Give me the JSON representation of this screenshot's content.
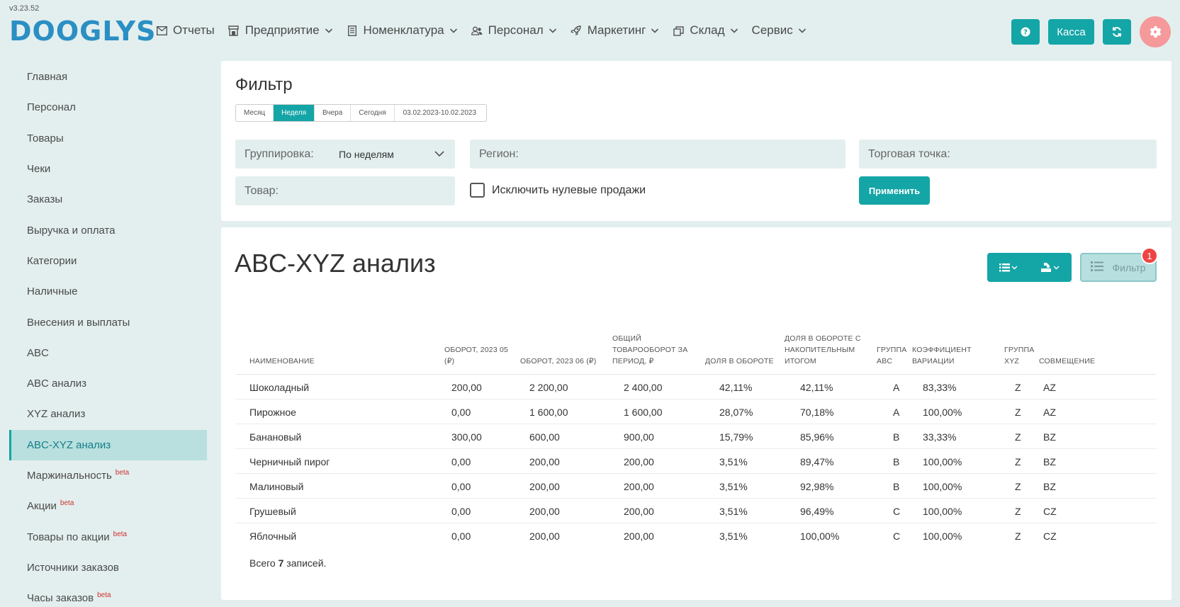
{
  "app": {
    "version": "v3.23.52",
    "logo": "DOOGLYS"
  },
  "nav": [
    {
      "label": "Отчеты",
      "icon": "envelope-icon",
      "dropdown": false
    },
    {
      "label": "Предприятие",
      "icon": "store-icon",
      "dropdown": true
    },
    {
      "label": "Номенклатура",
      "icon": "document-icon",
      "dropdown": true
    },
    {
      "label": "Персонал",
      "icon": "users-icon",
      "dropdown": true
    },
    {
      "label": "Маркетинг",
      "icon": "rocket-icon",
      "dropdown": true
    },
    {
      "label": "Склад",
      "icon": "boxes-icon",
      "dropdown": true
    },
    {
      "label": "Сервис",
      "icon": "",
      "dropdown": true
    }
  ],
  "header_buttons": {
    "help_icon": "question-icon",
    "kassa": "Касса",
    "refresh_icon": "refresh-icon",
    "settings_icon": "gear-icon"
  },
  "sidebar": [
    {
      "label": "Главная"
    },
    {
      "label": "Персонал"
    },
    {
      "label": "Товары"
    },
    {
      "label": "Чеки"
    },
    {
      "label": "Заказы"
    },
    {
      "label": "Выручка и оплата"
    },
    {
      "label": "Категории"
    },
    {
      "label": "Наличные"
    },
    {
      "label": "Внесения и выплаты"
    },
    {
      "label": "ABC"
    },
    {
      "label": "ABC анализ"
    },
    {
      "label": "XYZ анализ"
    },
    {
      "label": "ABC-XYZ анализ",
      "active": true
    },
    {
      "label": "Маржинальность",
      "beta": "beta"
    },
    {
      "label": "Акции",
      "beta": "beta"
    },
    {
      "label": "Товары по акции",
      "beta": "beta"
    },
    {
      "label": "Источники заказов"
    },
    {
      "label": "Часы заказов",
      "beta": "beta"
    }
  ],
  "filter": {
    "title": "Фильтр",
    "periods": [
      "Месяц",
      "Неделя",
      "Вчера",
      "Сегодня",
      "03.02.2023-10.02.2023"
    ],
    "selected_period": "Неделя",
    "grouping_label": "Группировка:",
    "grouping_value": "По неделям",
    "region_label": "Регион:",
    "outlet_label": "Торговая точка:",
    "product_label": "Товар:",
    "exclude_zero_label": "Исключить нулевые продажи",
    "exclude_zero_checked": false,
    "apply_label": "Применить"
  },
  "report": {
    "title": "ABC-XYZ анализ",
    "filter_button": "Фильтр",
    "filter_badge": "1",
    "columns": [
      "НАИМЕНОВАНИЕ",
      "ОБОРОТ, 2023 05 (₽)",
      "ОБОРОТ, 2023 06 (₽)",
      "ОБЩИЙ ТОВАРООБОРОТ ЗА ПЕРИОД, ₽",
      "ДОЛЯ В ОБОРОТЕ",
      "ДОЛЯ В ОБОРОТЕ С НАКОПИТЕЛЬНЫМ ИТОГОМ",
      "ГРУППА ABC",
      "КОЭФФИЦИЕНТ ВАРИАЦИИ",
      "ГРУППА XYZ",
      "СОВМЕЩЕНИЕ"
    ],
    "rows": [
      [
        "Шоколадный",
        "200,00",
        "2 200,00",
        "2 400,00",
        "42,11%",
        "42,11%",
        "A",
        "83,33%",
        "Z",
        "AZ"
      ],
      [
        "Пирожное",
        "0,00",
        "1 600,00",
        "1 600,00",
        "28,07%",
        "70,18%",
        "A",
        "100,00%",
        "Z",
        "AZ"
      ],
      [
        "Банановый",
        "300,00",
        "600,00",
        "900,00",
        "15,79%",
        "85,96%",
        "B",
        "33,33%",
        "Z",
        "BZ"
      ],
      [
        "Черничный пирог",
        "0,00",
        "200,00",
        "200,00",
        "3,51%",
        "89,47%",
        "B",
        "100,00%",
        "Z",
        "BZ"
      ],
      [
        "Малиновый",
        "0,00",
        "200,00",
        "200,00",
        "3,51%",
        "92,98%",
        "B",
        "100,00%",
        "Z",
        "BZ"
      ],
      [
        "Грушевый",
        "0,00",
        "200,00",
        "200,00",
        "3,51%",
        "96,49%",
        "C",
        "100,00%",
        "Z",
        "CZ"
      ],
      [
        "Яблочный",
        "0,00",
        "200,00",
        "200,00",
        "3,51%",
        "100,00%",
        "C",
        "100,00%",
        "Z",
        "CZ"
      ]
    ],
    "total_prefix": "Всего",
    "total_count": "7",
    "total_suffix": "записей."
  }
}
